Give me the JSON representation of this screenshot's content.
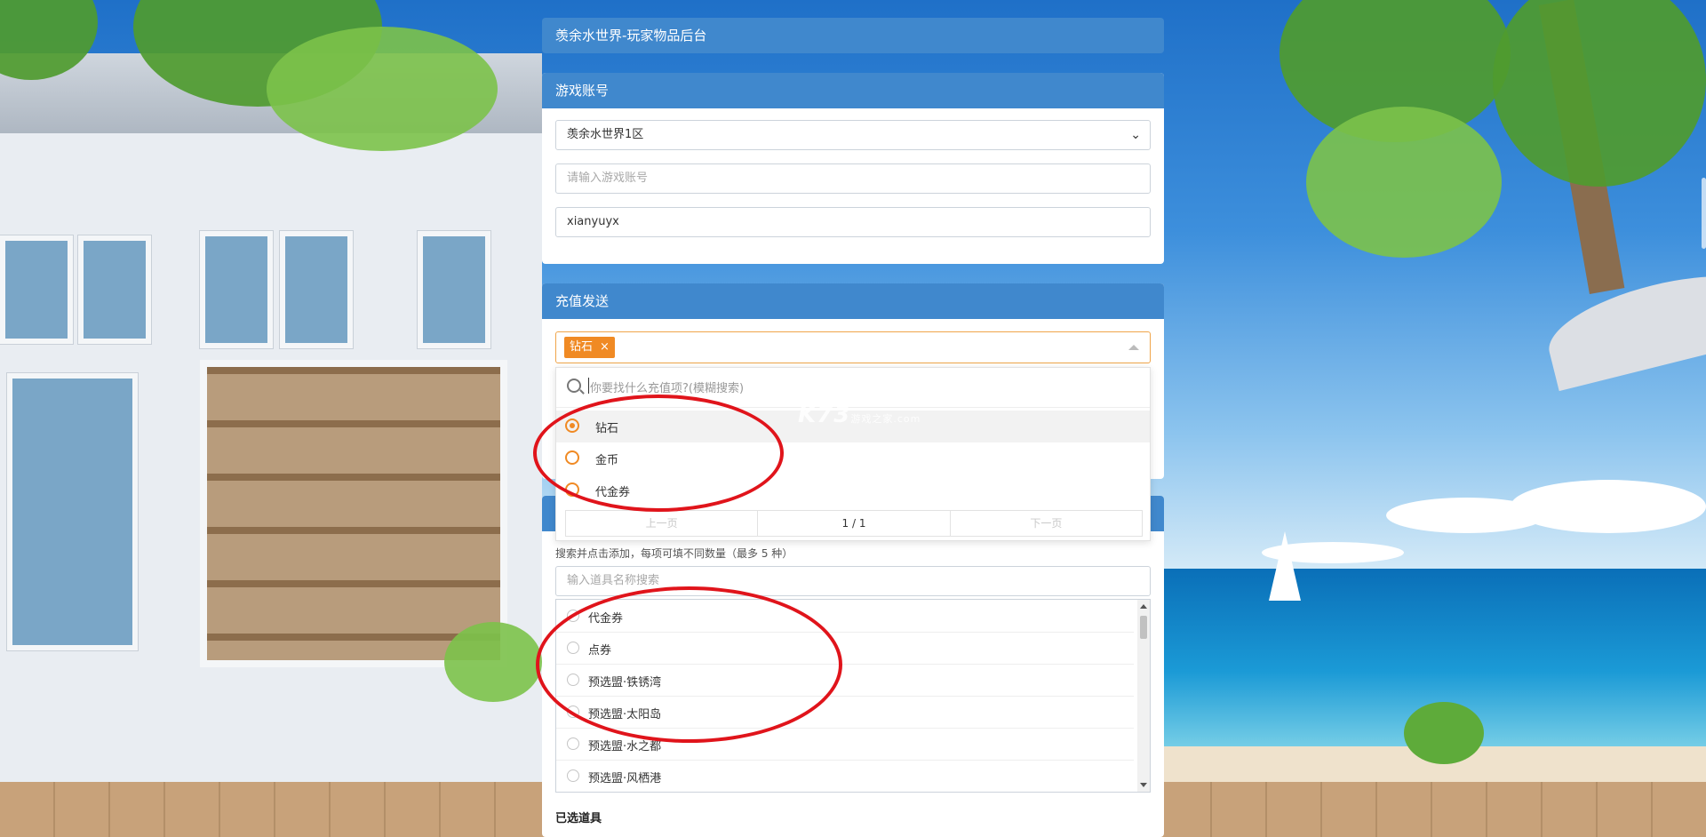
{
  "app": {
    "title": "羡余水世界-玩家物品后台"
  },
  "account": {
    "header": "游戏账号",
    "server_value": "羡余水世界1区",
    "account_placeholder": "请输入游戏账号",
    "account_value": "xianyuyx"
  },
  "recharge": {
    "header": "充值发送",
    "selected_tag": "钻石",
    "tag_remove": "×",
    "search_placeholder": "你要找什么充值项?(模糊搜索)",
    "options": [
      "钻石",
      "金币",
      "代金券"
    ],
    "pager": {
      "prev": "上一页",
      "page": "1 / 1",
      "next": "下一页"
    }
  },
  "items": {
    "hint": "搜索并点击添加，每项可填不同数量（最多 5 种）",
    "search_placeholder": "输入道具名称搜索",
    "list": [
      "代金券",
      "点券",
      "预选盟·铁锈湾",
      "预选盟·太阳岛",
      "预选盟·水之都",
      "预选盟·风栖港"
    ],
    "selected_title": "已选道具"
  },
  "watermark": {
    "brand": "K73",
    "sub": "游戏之家",
    "domain": ".com"
  },
  "colors": {
    "header": "#4088cd",
    "accent": "#f08a24",
    "annotation": "#e0141b"
  }
}
